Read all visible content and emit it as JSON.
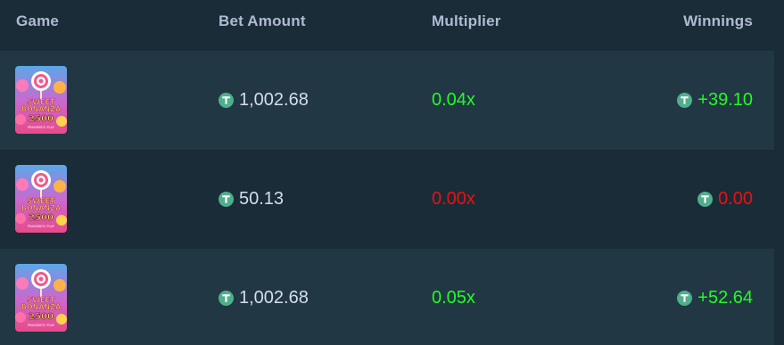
{
  "headers": {
    "game": "Game",
    "bet_amount": "Bet Amount",
    "multiplier": "Multiplier",
    "winnings": "Winnings"
  },
  "colors": {
    "background": "#1a2c38",
    "row_alt": "#213743",
    "header_text": "#b1bad3",
    "positive": "#1fff20",
    "negative": "#ed1010",
    "coin": "#4fae8c"
  },
  "thumbnail": {
    "line1": "SWEET",
    "line2": "BONANZA",
    "line3": "2500",
    "line4": "PRAGMATIC PLAY"
  },
  "rows": [
    {
      "bet": "1,002.68",
      "multiplier": "0.04x",
      "winnings": "+39.10",
      "status": "positive"
    },
    {
      "bet": "50.13",
      "multiplier": "0.00x",
      "winnings": "0.00",
      "status": "negative"
    },
    {
      "bet": "1,002.68",
      "multiplier": "0.05x",
      "winnings": "+52.64",
      "status": "positive"
    }
  ],
  "icons": {
    "currency": "usdt-coin-icon",
    "game": "sweet-bonanza-thumbnail"
  }
}
